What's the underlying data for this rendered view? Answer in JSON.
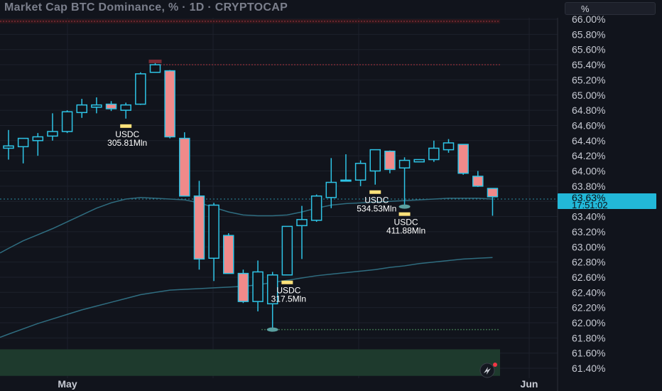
{
  "header": {
    "title": "Market Cap BTC Dominance, % · 1D · CRYPTOCAP",
    "unit_label": "%"
  },
  "price_tag": {
    "value": "63.63%",
    "countdown": "17:51:02",
    "color": "#22b8d8"
  },
  "colors": {
    "up": "#2ec4e6",
    "down_fill": "#f08a8a",
    "red_line": "#7a2b35",
    "green_zone": "#1e3a2d",
    "ma_color": "#2f6d80",
    "marker": "#ffe27a"
  },
  "chart_data": {
    "type": "candlestick",
    "title": "Market Cap BTC Dominance, % · 1D · CRYPTOCAP",
    "ylim": [
      61.3,
      66.1
    ],
    "y_ticks": [
      "66.00%",
      "65.80%",
      "65.60%",
      "65.40%",
      "65.20%",
      "65.00%",
      "64.80%",
      "64.60%",
      "64.40%",
      "64.20%",
      "64.00%",
      "63.80%",
      "63.60%",
      "63.40%",
      "63.20%",
      "63.00%",
      "62.80%",
      "62.60%",
      "62.40%",
      "62.20%",
      "62.00%",
      "61.80%",
      "61.60%",
      "61.40%"
    ],
    "y_tick_values": [
      66.0,
      65.8,
      65.6,
      65.4,
      65.2,
      65.0,
      64.8,
      64.6,
      64.4,
      64.2,
      64.0,
      63.8,
      63.6,
      63.4,
      63.2,
      63.0,
      62.8,
      62.6,
      62.4,
      62.2,
      62.0,
      61.8,
      61.6,
      61.4
    ],
    "x_labels": [
      "May",
      "Jun"
    ],
    "candles": [
      {
        "o": 64.3,
        "h": 64.54,
        "l": 64.15,
        "c": 64.33
      },
      {
        "o": 64.32,
        "h": 64.42,
        "l": 64.1,
        "c": 64.43
      },
      {
        "o": 64.4,
        "h": 64.5,
        "l": 64.2,
        "c": 64.45
      },
      {
        "o": 64.46,
        "h": 64.76,
        "l": 64.4,
        "c": 64.52
      },
      {
        "o": 64.52,
        "h": 64.8,
        "l": 64.5,
        "c": 64.78
      },
      {
        "o": 64.77,
        "h": 64.95,
        "l": 64.7,
        "c": 64.87
      },
      {
        "o": 64.84,
        "h": 64.97,
        "l": 64.76,
        "c": 64.87
      },
      {
        "o": 64.88,
        "h": 64.92,
        "l": 64.79,
        "c": 64.82
      },
      {
        "o": 64.8,
        "h": 64.9,
        "l": 64.69,
        "c": 64.87
      },
      {
        "o": 64.88,
        "h": 65.3,
        "l": 64.87,
        "c": 65.28
      },
      {
        "o": 65.3,
        "h": 65.43,
        "l": 65.3,
        "c": 65.4
      },
      {
        "o": 65.32,
        "h": 65.33,
        "l": 64.43,
        "c": 64.45
      },
      {
        "o": 64.43,
        "h": 64.51,
        "l": 63.68,
        "c": 63.67
      },
      {
        "o": 63.67,
        "h": 63.87,
        "l": 62.7,
        "c": 62.84
      },
      {
        "o": 62.85,
        "h": 63.58,
        "l": 62.55,
        "c": 63.55
      },
      {
        "o": 63.15,
        "h": 63.18,
        "l": 62.65,
        "c": 62.65
      },
      {
        "o": 62.65,
        "h": 62.7,
        "l": 62.26,
        "c": 62.28
      },
      {
        "o": 62.28,
        "h": 62.82,
        "l": 62.15,
        "c": 62.67
      },
      {
        "o": 62.25,
        "h": 62.67,
        "l": 61.92,
        "c": 62.63
      },
      {
        "o": 62.63,
        "h": 63.27,
        "l": 62.64,
        "c": 63.27
      },
      {
        "o": 63.28,
        "h": 63.54,
        "l": 62.84,
        "c": 63.36
      },
      {
        "o": 63.35,
        "h": 63.69,
        "l": 63.33,
        "c": 63.67
      },
      {
        "o": 63.65,
        "h": 64.17,
        "l": 63.51,
        "c": 63.85
      },
      {
        "o": 63.88,
        "h": 64.22,
        "l": 63.87,
        "c": 63.88
      },
      {
        "o": 63.88,
        "h": 64.14,
        "l": 63.8,
        "c": 64.1
      },
      {
        "o": 64.0,
        "h": 64.24,
        "l": 63.82,
        "c": 64.28
      },
      {
        "o": 64.26,
        "h": 64.27,
        "l": 63.97,
        "c": 64.02
      },
      {
        "o": 64.04,
        "h": 64.18,
        "l": 63.53,
        "c": 64.14
      },
      {
        "o": 64.12,
        "h": 64.14,
        "l": 64.12,
        "c": 64.15
      },
      {
        "o": 64.15,
        "h": 64.4,
        "l": 64.12,
        "c": 64.3
      },
      {
        "o": 64.28,
        "h": 64.42,
        "l": 64.24,
        "c": 64.37
      },
      {
        "o": 64.35,
        "h": 64.35,
        "l": 63.95,
        "c": 63.97
      },
      {
        "o": 63.93,
        "h": 64.0,
        "l": 63.79,
        "c": 63.8
      },
      {
        "o": 63.77,
        "h": 63.77,
        "l": 63.41,
        "c": 63.66
      }
    ],
    "moving_average_fast": [
      62.98,
      63.08,
      63.16,
      63.24,
      63.33,
      63.42,
      63.51,
      63.58,
      63.63,
      63.65,
      63.64,
      63.63,
      63.62,
      63.58,
      63.52,
      63.46,
      63.42,
      63.41,
      63.41,
      63.42,
      63.46,
      63.51,
      63.55,
      63.57,
      63.58,
      63.59,
      63.6,
      63.61,
      63.62,
      63.63,
      63.64,
      63.64,
      63.64,
      63.63
    ],
    "moving_average_slow": [
      61.85,
      61.92,
      61.99,
      62.05,
      62.11,
      62.17,
      62.22,
      62.27,
      62.32,
      62.37,
      62.4,
      62.43,
      62.44,
      62.45,
      62.46,
      62.47,
      62.48,
      62.5,
      62.53,
      62.56,
      62.59,
      62.62,
      62.64,
      62.66,
      62.68,
      62.7,
      62.73,
      62.75,
      62.78,
      62.8,
      62.82,
      62.84,
      62.85,
      62.86
    ],
    "levels": [
      {
        "value": 65.4,
        "color": "#7a2b35"
      },
      {
        "value": 61.91,
        "color": "#3a6b4a"
      }
    ],
    "zone": {
      "from": 61.3,
      "to": 61.65
    },
    "annotations": [
      {
        "candle": 8,
        "label": "USDC",
        "value": "305.81Mln",
        "side": "below"
      },
      {
        "candle": 19,
        "label": "USDC",
        "value": "317.5Mln",
        "side": "below"
      },
      {
        "candle": 25,
        "label": "USDC",
        "value": "534.53Mln",
        "side": "below"
      },
      {
        "candle": 27,
        "label": "USDC",
        "value": "411.88Mln",
        "side": "below"
      }
    ]
  }
}
